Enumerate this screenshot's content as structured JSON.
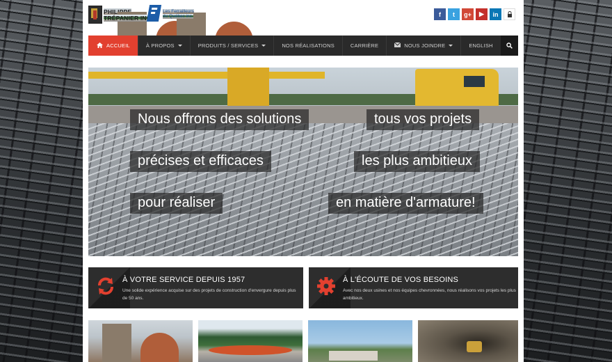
{
  "header": {
    "logo_pt": {
      "line1": "PHILIPPE",
      "line2": "TRÉPANIER INC."
    },
    "logo_fq": {
      "line1": "Les Ferrailleurs",
      "line2": "du Québec inc."
    },
    "socials": [
      {
        "icon": "facebook-icon",
        "glyph": "f",
        "color": "#3b5b9a"
      },
      {
        "icon": "twitter-icon",
        "glyph": "t",
        "color": "#3aa2e0"
      },
      {
        "icon": "google-plus-icon",
        "glyph": "g+",
        "color": "#d14836"
      },
      {
        "icon": "youtube-icon",
        "glyph": "▶",
        "color": "#c4302b"
      },
      {
        "icon": "linkedin-icon",
        "glyph": "in",
        "color": "#0a77b5"
      },
      {
        "icon": "lock-icon",
        "glyph": "🔒",
        "color": "#ffffff"
      }
    ]
  },
  "nav": {
    "items": [
      {
        "label": "ACCUEIL",
        "active": true,
        "icon": "home-icon"
      },
      {
        "label": "À PROPOS",
        "dropdown": true
      },
      {
        "label": "PRODUITS / SERVICES",
        "dropdown": true
      },
      {
        "label": "NOS RÉALISATIONS"
      },
      {
        "label": "CARRIÈRE"
      },
      {
        "label": "NOUS JOINDRE",
        "dropdown": true,
        "icon": "envelope-icon"
      },
      {
        "label": "ENGLISH"
      }
    ],
    "search_icon": "search-icon",
    "accent": "#e2402f"
  },
  "hero": {
    "captions": [
      "Nous offrons des solutions",
      "tous vos projets",
      "précises et efficaces",
      "les plus ambitieux",
      "pour réaliser",
      "en matière d'armature!"
    ]
  },
  "features": [
    {
      "icon": "refresh-icon",
      "title": "À VOTRE SERVICE DEPUIS 1957",
      "description": "Une solide expérience acquise sur des projets de construction d'envergure depuis plus de 50 ans."
    },
    {
      "icon": "gear-icon",
      "title": "À L'ÉCOUTE DE VOS BESOINS",
      "description": "Avec nos deux usines et nos équipes chevronnées, nous réalisons vos projets les plus ambitieux."
    }
  ]
}
